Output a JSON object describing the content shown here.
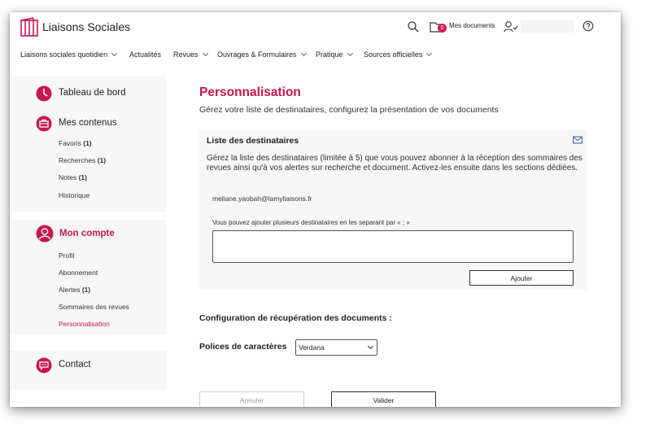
{
  "header": {
    "brand": "Liaisons Sociales",
    "documents_label": "Mes documents",
    "documents_count": "0"
  },
  "nav": {
    "items": [
      {
        "label": "Liaisons sociales quotidien",
        "dropdown": true
      },
      {
        "label": "Actualités",
        "dropdown": false
      },
      {
        "label": "Revues",
        "dropdown": true
      },
      {
        "label": "Ouvrages & Formulaires",
        "dropdown": true
      },
      {
        "label": "Pratique",
        "dropdown": true
      },
      {
        "label": "Sources officielles",
        "dropdown": true
      }
    ]
  },
  "sidebar": {
    "dashboard": "Tableau de bord",
    "contents": {
      "title": "Mes contenus",
      "items": [
        {
          "label": "Favoris",
          "count": "(1)"
        },
        {
          "label": "Recherches",
          "count": "(1)"
        },
        {
          "label": "Notes",
          "count": "(1)"
        },
        {
          "label": "Historique",
          "count": ""
        }
      ]
    },
    "account": {
      "title": "Mon compte",
      "items": [
        {
          "label": "Profil",
          "count": ""
        },
        {
          "label": "Abonnement",
          "count": ""
        },
        {
          "label": "Alertes",
          "count": "(1)"
        },
        {
          "label": "Sommaires des revues",
          "count": ""
        },
        {
          "label": "Personnalisation",
          "count": ""
        }
      ]
    },
    "contact": "Contact"
  },
  "main": {
    "title": "Personnalisation",
    "subtitle": "Gérez votre liste de destinataires, configurez la présentation de vos documents",
    "recipients": {
      "title": "Liste des destinataires",
      "description": "Gérez la liste des destinataires (limitée à 5) que vous pouvez abonner à la réception des sommaires des revues ainsi qu'à vos alertes sur recherche et document. Activez-les ensuite dans les sections dédiées.",
      "email": "meliane.yaobah@lamyliaisons.fr",
      "help": "Vous pouvez ajouter plusieurs destinataires en les separant par « ; »",
      "textarea_value": "",
      "add_label": "Ajouter"
    },
    "config_title": "Configuration de récupération des documents :",
    "fonts_label": "Polices de caractères",
    "fonts_selected": "Verdana",
    "cancel_label": "Annuler",
    "submit_label": "Valider"
  },
  "colors": {
    "accent": "#c8174c",
    "badge": "#d6174f",
    "sidebar_bg": "#f7f7f7"
  }
}
